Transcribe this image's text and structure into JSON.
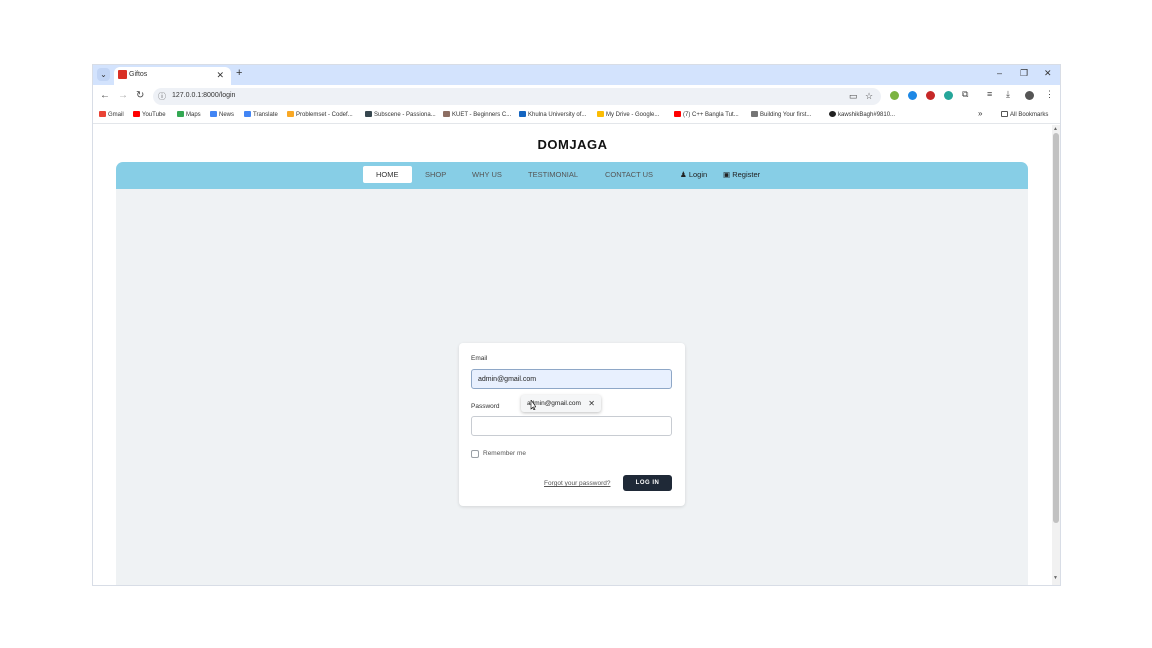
{
  "browser": {
    "tab": {
      "title": "Giftos",
      "close": "✕"
    },
    "new_tab": "+",
    "window_controls": {
      "minimize": "–",
      "restore": "❐",
      "close": "✕"
    },
    "url": "127.0.0.1:8000/login",
    "bookmarks": [
      {
        "label": "Gmail",
        "color": "#ea4335"
      },
      {
        "label": "YouTube",
        "color": "#ff0000"
      },
      {
        "label": "Maps",
        "color": "#34a853"
      },
      {
        "label": "News",
        "color": "#4285f4"
      },
      {
        "label": "Translate",
        "color": "#4285f4"
      },
      {
        "label": "Problemset - Codef...",
        "color": "#f9a825"
      },
      {
        "label": "Subscene - Passiona...",
        "color": "#37474f"
      },
      {
        "label": "KUET - Beginners C...",
        "color": "#8d6e63"
      },
      {
        "label": "Khulna University of...",
        "color": "#1565c0"
      },
      {
        "label": "My Drive - Google...",
        "color": "#fbbc04"
      },
      {
        "label": "(7) C++ Bangla Tut...",
        "color": "#ff0000"
      },
      {
        "label": "Building Your first...",
        "color": "#757575"
      },
      {
        "label": "kawshikBagh#9810...",
        "color": "#212121"
      }
    ],
    "bookmarks_overflow": "»",
    "all_bookmarks": "All Bookmarks"
  },
  "site": {
    "brand": "DOMJAGA",
    "nav": {
      "items": [
        "HOME",
        "SHOP",
        "WHY US",
        "TESTIMONIAL",
        "CONTACT US"
      ],
      "active": "HOME",
      "login": "Login",
      "register": "Register"
    }
  },
  "login_form": {
    "email_label": "Email",
    "email_value": "admin@gmail.com",
    "password_label": "Password",
    "password_value": "",
    "autofill_suggestion": "admin@gmail.com",
    "remember_label": "Remember me",
    "remember_checked": false,
    "forgot_link": "Forgot your password?",
    "submit_label": "LOG IN"
  },
  "colors": {
    "navbar": "#87cee6",
    "content_bg": "#eff2f4",
    "button": "#1f2937"
  }
}
